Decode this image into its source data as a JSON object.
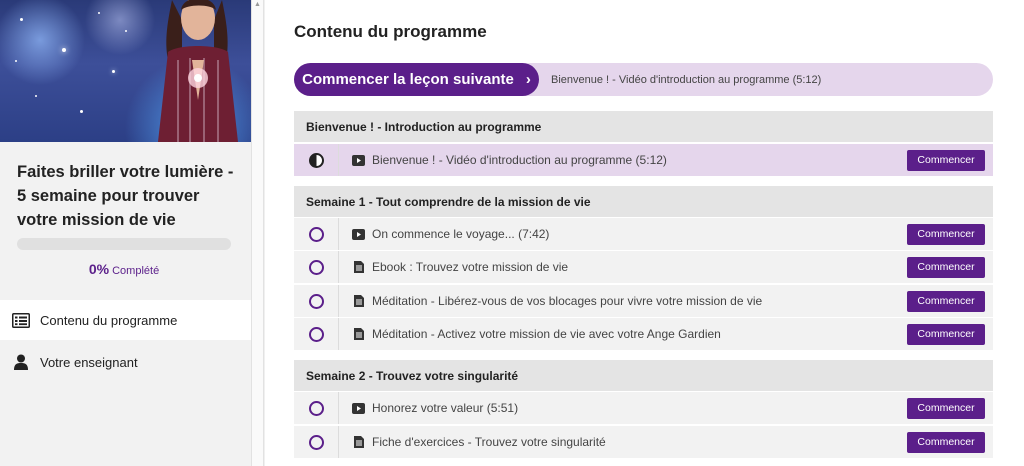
{
  "sidebar": {
    "course_title": "Faites briller votre lumière - 5 semaine pour trouver votre mission de vie",
    "progress": {
      "percent_value": 0,
      "percent": "0%",
      "label": "Complété"
    },
    "nav": [
      {
        "label": "Contenu du programme",
        "icon": "list-icon",
        "active": true
      },
      {
        "label": "Votre enseignant",
        "icon": "user-icon",
        "active": false
      }
    ]
  },
  "main": {
    "title": "Contenu du programme",
    "next_lesson": {
      "button_label": "Commencer la leçon suivante",
      "chevron": "›",
      "lesson_title": "Bienvenue ! - Vidéo d'introduction au programme (5:12)"
    },
    "sections": [
      {
        "title": "Bienvenue ! - Introduction au programme",
        "lessons": [
          {
            "title": "Bienvenue ! - Vidéo d'introduction au programme (5:12)",
            "type": "video-icon",
            "status": "in-progress",
            "button": "Commencer"
          }
        ]
      },
      {
        "title": "Semaine 1 - Tout comprendre de la mission de vie",
        "lessons": [
          {
            "title": "On commence le voyage... (7:42)",
            "type": "video-icon",
            "status": "not-started",
            "button": "Commencer"
          },
          {
            "title": "Ebook : Trouvez votre mission de vie",
            "type": "document-icon",
            "status": "not-started",
            "button": "Commencer"
          },
          {
            "title": "Méditation - Libérez-vous de vos blocages pour vivre votre mission de vie",
            "type": "document-icon",
            "status": "not-started",
            "button": "Commencer"
          },
          {
            "title": "Méditation - Activez votre mission de vie avec votre Ange Gardien",
            "type": "document-icon",
            "status": "not-started",
            "button": "Commencer"
          }
        ]
      },
      {
        "title": "Semaine 2 - Trouvez votre singularité",
        "lessons": [
          {
            "title": "Honorez votre valeur (5:51)",
            "type": "video-icon",
            "status": "not-started",
            "button": "Commencer"
          },
          {
            "title": "Fiche d'exercices - Trouvez votre singularité",
            "type": "document-icon",
            "status": "not-started",
            "button": "Commencer"
          }
        ]
      }
    ]
  },
  "colors": {
    "accent": "#5b1f8a",
    "accent_light": "#e5d6ec",
    "section_bg": "#e4e4e4",
    "row_bg": "#f2f2f2"
  }
}
